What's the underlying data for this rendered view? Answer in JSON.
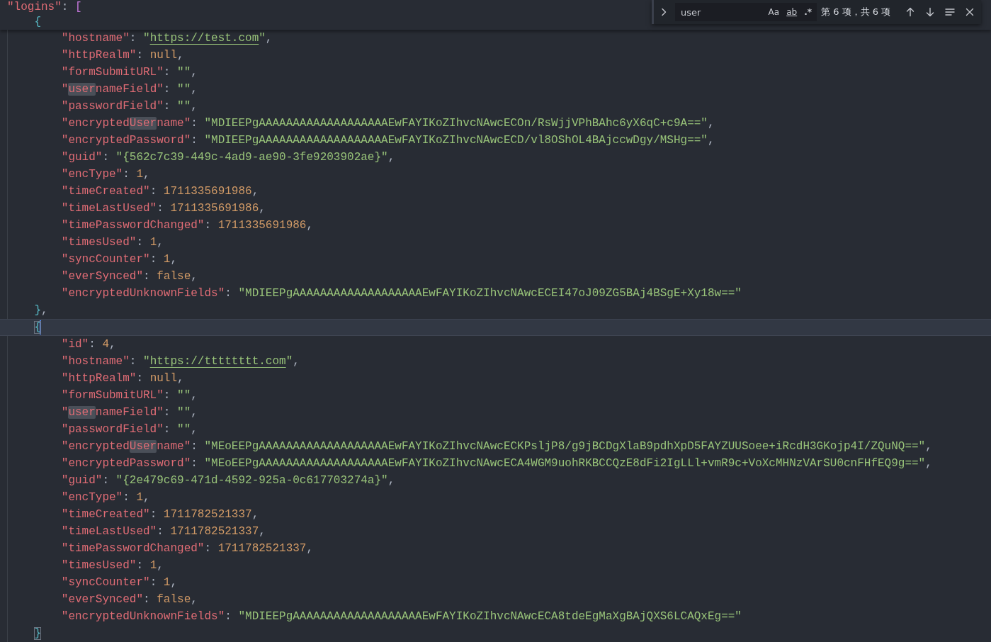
{
  "sticky_header": {
    "lines": [
      {
        "kind": "top",
        "tokens": [
          {
            "kind": "key",
            "text": "\"logins\""
          },
          {
            "kind": "punct",
            "text": ": "
          },
          {
            "kind": "bracket",
            "text": "["
          }
        ]
      },
      {
        "kind": "brace",
        "tokens": [
          {
            "kind": "brace",
            "text": "{"
          }
        ]
      }
    ]
  },
  "editor": {
    "lines": [
      {
        "kind": "member",
        "current": false,
        "tokens": [
          {
            "kind": "key",
            "text": "\"hostname\""
          },
          {
            "kind": "punct",
            "text": ": "
          },
          {
            "kind": "str",
            "text": "\""
          },
          {
            "kind": "link",
            "text": "https://test.com"
          },
          {
            "kind": "str",
            "text": "\""
          },
          {
            "kind": "punct",
            "text": ","
          }
        ]
      },
      {
        "kind": "member",
        "current": false,
        "tokens": [
          {
            "kind": "key",
            "text": "\"httpRealm\""
          },
          {
            "kind": "punct",
            "text": ": "
          },
          {
            "kind": "lit",
            "text": "null"
          },
          {
            "kind": "punct",
            "text": ","
          }
        ]
      },
      {
        "kind": "member",
        "current": false,
        "tokens": [
          {
            "kind": "key",
            "text": "\"formSubmitURL\""
          },
          {
            "kind": "punct",
            "text": ": "
          },
          {
            "kind": "str",
            "text": "\"\""
          },
          {
            "kind": "punct",
            "text": ","
          }
        ]
      },
      {
        "kind": "member",
        "current": false,
        "tokens": [
          {
            "kind": "key",
            "text": "\""
          },
          {
            "kind": "match",
            "text": "user"
          },
          {
            "kind": "key",
            "text": "nameField\""
          },
          {
            "kind": "punct",
            "text": ": "
          },
          {
            "kind": "str",
            "text": "\"\""
          },
          {
            "kind": "punct",
            "text": ","
          }
        ]
      },
      {
        "kind": "member",
        "current": false,
        "tokens": [
          {
            "kind": "key",
            "text": "\"passwordField\""
          },
          {
            "kind": "punct",
            "text": ": "
          },
          {
            "kind": "str",
            "text": "\"\""
          },
          {
            "kind": "punct",
            "text": ","
          }
        ]
      },
      {
        "kind": "member",
        "current": false,
        "tokens": [
          {
            "kind": "key",
            "text": "\"encrypted"
          },
          {
            "kind": "match",
            "text": "User"
          },
          {
            "kind": "key",
            "text": "name\""
          },
          {
            "kind": "punct",
            "text": ": "
          },
          {
            "kind": "str",
            "text": "\"MDIEEPgAAAAAAAAAAAAAAAAAAAEwFAYIKoZIhvcNAwcECOn/RsWjjVPhBAhc6yX6qC+c9A==\""
          },
          {
            "kind": "punct",
            "text": ","
          }
        ]
      },
      {
        "kind": "member",
        "current": false,
        "tokens": [
          {
            "kind": "key",
            "text": "\"encryptedPassword\""
          },
          {
            "kind": "punct",
            "text": ": "
          },
          {
            "kind": "str",
            "text": "\"MDIEEPgAAAAAAAAAAAAAAAAAAAEwFAYIKoZIhvcNAwcECD/vl8OShOL4BAjccwDgy/MSHg==\""
          },
          {
            "kind": "punct",
            "text": ","
          }
        ]
      },
      {
        "kind": "member",
        "current": false,
        "tokens": [
          {
            "kind": "key",
            "text": "\"guid\""
          },
          {
            "kind": "punct",
            "text": ": "
          },
          {
            "kind": "str",
            "text": "\"{562c7c39-449c-4ad9-ae90-3fe9203902ae}\""
          },
          {
            "kind": "punct",
            "text": ","
          }
        ]
      },
      {
        "kind": "member",
        "current": false,
        "tokens": [
          {
            "kind": "key",
            "text": "\"encType\""
          },
          {
            "kind": "punct",
            "text": ": "
          },
          {
            "kind": "num",
            "text": "1"
          },
          {
            "kind": "punct",
            "text": ","
          }
        ]
      },
      {
        "kind": "member",
        "current": false,
        "tokens": [
          {
            "kind": "key",
            "text": "\"timeCreated\""
          },
          {
            "kind": "punct",
            "text": ": "
          },
          {
            "kind": "num",
            "text": "1711335691986"
          },
          {
            "kind": "punct",
            "text": ","
          }
        ]
      },
      {
        "kind": "member",
        "current": false,
        "tokens": [
          {
            "kind": "key",
            "text": "\"timeLastUsed\""
          },
          {
            "kind": "punct",
            "text": ": "
          },
          {
            "kind": "num",
            "text": "1711335691986"
          },
          {
            "kind": "punct",
            "text": ","
          }
        ]
      },
      {
        "kind": "member",
        "current": false,
        "tokens": [
          {
            "kind": "key",
            "text": "\"timePasswordChanged\""
          },
          {
            "kind": "punct",
            "text": ": "
          },
          {
            "kind": "num",
            "text": "1711335691986"
          },
          {
            "kind": "punct",
            "text": ","
          }
        ]
      },
      {
        "kind": "member",
        "current": false,
        "tokens": [
          {
            "kind": "key",
            "text": "\"timesUsed\""
          },
          {
            "kind": "punct",
            "text": ": "
          },
          {
            "kind": "num",
            "text": "1"
          },
          {
            "kind": "punct",
            "text": ","
          }
        ]
      },
      {
        "kind": "member",
        "current": false,
        "tokens": [
          {
            "kind": "key",
            "text": "\"syncCounter\""
          },
          {
            "kind": "punct",
            "text": ": "
          },
          {
            "kind": "num",
            "text": "1"
          },
          {
            "kind": "punct",
            "text": ","
          }
        ]
      },
      {
        "kind": "member",
        "current": false,
        "tokens": [
          {
            "kind": "key",
            "text": "\"everSynced\""
          },
          {
            "kind": "punct",
            "text": ": "
          },
          {
            "kind": "lit",
            "text": "false"
          },
          {
            "kind": "punct",
            "text": ","
          }
        ]
      },
      {
        "kind": "member",
        "current": false,
        "tokens": [
          {
            "kind": "key",
            "text": "\"encryptedUnknownFields\""
          },
          {
            "kind": "punct",
            "text": ": "
          },
          {
            "kind": "str",
            "text": "\"MDIEEPgAAAAAAAAAAAAAAAAAAAEwFAYIKoZIhvcNAwcECEI47oJ09ZG5BAj4BSgE+Xy18w==\""
          }
        ]
      },
      {
        "kind": "brace",
        "current": false,
        "tokens": [
          {
            "kind": "brace",
            "text": "}"
          },
          {
            "kind": "punct",
            "text": ","
          }
        ]
      },
      {
        "kind": "brace",
        "current": true,
        "tokens": [
          {
            "kind": "brace_match",
            "text": "{"
          }
        ]
      },
      {
        "kind": "member",
        "current": false,
        "tokens": [
          {
            "kind": "key",
            "text": "\"id\""
          },
          {
            "kind": "punct",
            "text": ": "
          },
          {
            "kind": "num",
            "text": "4"
          },
          {
            "kind": "punct",
            "text": ","
          }
        ]
      },
      {
        "kind": "member",
        "current": false,
        "tokens": [
          {
            "kind": "key",
            "text": "\"hostname\""
          },
          {
            "kind": "punct",
            "text": ": "
          },
          {
            "kind": "str",
            "text": "\""
          },
          {
            "kind": "link",
            "text": "https://tttttttt.com"
          },
          {
            "kind": "str",
            "text": "\""
          },
          {
            "kind": "punct",
            "text": ","
          }
        ]
      },
      {
        "kind": "member",
        "current": false,
        "tokens": [
          {
            "kind": "key",
            "text": "\"httpRealm\""
          },
          {
            "kind": "punct",
            "text": ": "
          },
          {
            "kind": "lit",
            "text": "null"
          },
          {
            "kind": "punct",
            "text": ","
          }
        ]
      },
      {
        "kind": "member",
        "current": false,
        "tokens": [
          {
            "kind": "key",
            "text": "\"formSubmitURL\""
          },
          {
            "kind": "punct",
            "text": ": "
          },
          {
            "kind": "str",
            "text": "\"\""
          },
          {
            "kind": "punct",
            "text": ","
          }
        ]
      },
      {
        "kind": "member",
        "current": false,
        "tokens": [
          {
            "kind": "key",
            "text": "\""
          },
          {
            "kind": "match",
            "text": "user"
          },
          {
            "kind": "key",
            "text": "nameField\""
          },
          {
            "kind": "punct",
            "text": ": "
          },
          {
            "kind": "str",
            "text": "\"\""
          },
          {
            "kind": "punct",
            "text": ","
          }
        ]
      },
      {
        "kind": "member",
        "current": false,
        "tokens": [
          {
            "kind": "key",
            "text": "\"passwordField\""
          },
          {
            "kind": "punct",
            "text": ": "
          },
          {
            "kind": "str",
            "text": "\"\""
          },
          {
            "kind": "punct",
            "text": ","
          }
        ]
      },
      {
        "kind": "member",
        "current": false,
        "tokens": [
          {
            "kind": "key",
            "text": "\"encrypted"
          },
          {
            "kind": "match",
            "text": "User"
          },
          {
            "kind": "key",
            "text": "name\""
          },
          {
            "kind": "punct",
            "text": ": "
          },
          {
            "kind": "str",
            "text": "\"MEoEEPgAAAAAAAAAAAAAAAAAAAEwFAYIKoZIhvcNAwcECKPsljP8/g9jBCDgXlaB9pdhXpD5FAYZUUSoee+iRcdH3GKojp4I/ZQuNQ==\""
          },
          {
            "kind": "punct",
            "text": ","
          }
        ]
      },
      {
        "kind": "member",
        "current": false,
        "tokens": [
          {
            "kind": "key",
            "text": "\"encryptedPassword\""
          },
          {
            "kind": "punct",
            "text": ": "
          },
          {
            "kind": "str",
            "text": "\"MEoEEPgAAAAAAAAAAAAAAAAAAAEwFAYIKoZIhvcNAwcECA4WGM9uohRKBCCQzE8dFi2IgLLl+vmR9c+VoXcMHNzVArSU0cnFHfEQ9g==\""
          },
          {
            "kind": "punct",
            "text": ","
          }
        ]
      },
      {
        "kind": "member",
        "current": false,
        "tokens": [
          {
            "kind": "key",
            "text": "\"guid\""
          },
          {
            "kind": "punct",
            "text": ": "
          },
          {
            "kind": "str",
            "text": "\"{2e479c69-471d-4592-925a-0c617703274a}\""
          },
          {
            "kind": "punct",
            "text": ","
          }
        ]
      },
      {
        "kind": "member",
        "current": false,
        "tokens": [
          {
            "kind": "key",
            "text": "\"encType\""
          },
          {
            "kind": "punct",
            "text": ": "
          },
          {
            "kind": "num",
            "text": "1"
          },
          {
            "kind": "punct",
            "text": ","
          }
        ]
      },
      {
        "kind": "member",
        "current": false,
        "tokens": [
          {
            "kind": "key",
            "text": "\"timeCreated\""
          },
          {
            "kind": "punct",
            "text": ": "
          },
          {
            "kind": "num",
            "text": "1711782521337"
          },
          {
            "kind": "punct",
            "text": ","
          }
        ]
      },
      {
        "kind": "member",
        "current": false,
        "tokens": [
          {
            "kind": "key",
            "text": "\"timeLastUsed\""
          },
          {
            "kind": "punct",
            "text": ": "
          },
          {
            "kind": "num",
            "text": "1711782521337"
          },
          {
            "kind": "punct",
            "text": ","
          }
        ]
      },
      {
        "kind": "member",
        "current": false,
        "tokens": [
          {
            "kind": "key",
            "text": "\"timePasswordChanged\""
          },
          {
            "kind": "punct",
            "text": ": "
          },
          {
            "kind": "num",
            "text": "1711782521337"
          },
          {
            "kind": "punct",
            "text": ","
          }
        ]
      },
      {
        "kind": "member",
        "current": false,
        "tokens": [
          {
            "kind": "key",
            "text": "\"timesUsed\""
          },
          {
            "kind": "punct",
            "text": ": "
          },
          {
            "kind": "num",
            "text": "1"
          },
          {
            "kind": "punct",
            "text": ","
          }
        ]
      },
      {
        "kind": "member",
        "current": false,
        "tokens": [
          {
            "kind": "key",
            "text": "\"syncCounter\""
          },
          {
            "kind": "punct",
            "text": ": "
          },
          {
            "kind": "num",
            "text": "1"
          },
          {
            "kind": "punct",
            "text": ","
          }
        ]
      },
      {
        "kind": "member",
        "current": false,
        "tokens": [
          {
            "kind": "key",
            "text": "\"everSynced\""
          },
          {
            "kind": "punct",
            "text": ": "
          },
          {
            "kind": "lit",
            "text": "false"
          },
          {
            "kind": "punct",
            "text": ","
          }
        ]
      },
      {
        "kind": "member",
        "current": false,
        "tokens": [
          {
            "kind": "key",
            "text": "\"encryptedUnknownFields\""
          },
          {
            "kind": "punct",
            "text": ": "
          },
          {
            "kind": "str",
            "text": "\"MDIEEPgAAAAAAAAAAAAAAAAAAAEwFAYIKoZIhvcNAwcECA8tdeEgMaXgBAjQXS6LCAQxEg==\""
          }
        ]
      },
      {
        "kind": "brace",
        "current": false,
        "tokens": [
          {
            "kind": "brace_match",
            "text": "}"
          }
        ]
      }
    ]
  },
  "find_widget": {
    "query": "user",
    "options": [
      {
        "label": "Aa",
        "kind": "case"
      },
      {
        "label": "ab",
        "kind": "word"
      },
      {
        "label": ".*",
        "kind": "regex"
      }
    ],
    "result": "第 6 项，共 6 项"
  }
}
